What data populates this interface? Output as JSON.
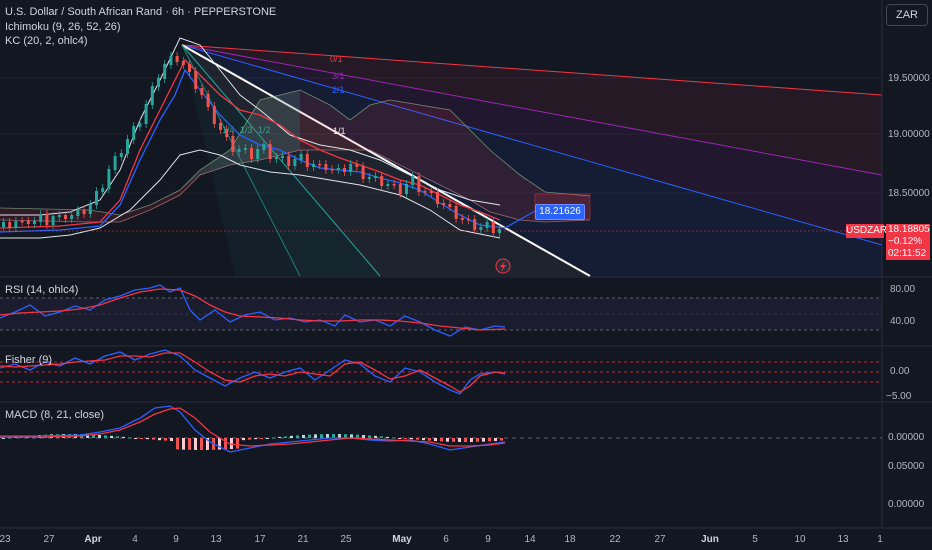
{
  "header": {
    "title": "U.S. Dollar / South African Rand · 6h · PEPPERSTONE",
    "currency_button": "ZAR"
  },
  "indicators": {
    "ichimoku": "Ichimoku (9, 26, 52, 26)",
    "keltner": "KC (20, 2, ohlc4)",
    "rsi": "RSI (14, ohlc4)",
    "fisher": "Fisher (9)",
    "macd": "MACD (8, 21, close)"
  },
  "price_axis": {
    "main": [
      "19.50000",
      "19.00000",
      "18.50000"
    ],
    "rsi": [
      "80.00",
      "40.00"
    ],
    "fisher": [
      "0.00",
      "−5.00"
    ],
    "macd": [
      "0.00000",
      "0.05000",
      "0.00000"
    ]
  },
  "last_price": {
    "symbol": "USDZAR",
    "price": "18.18805",
    "change": "−0.12%",
    "countdown": "02:11:52"
  },
  "callout": "18.21626",
  "fan_labels": [
    "0/1",
    "3/1",
    "2/1",
    "1/1",
    "1/4",
    "1/3",
    "1/2"
  ],
  "time_axis": [
    {
      "label": "23",
      "bold": false
    },
    {
      "label": "27",
      "bold": false
    },
    {
      "label": "Apr",
      "bold": true
    },
    {
      "label": "4",
      "bold": false
    },
    {
      "label": "9",
      "bold": false
    },
    {
      "label": "13",
      "bold": false
    },
    {
      "label": "17",
      "bold": false
    },
    {
      "label": "21",
      "bold": false
    },
    {
      "label": "25",
      "bold": false
    },
    {
      "label": "May",
      "bold": true
    },
    {
      "label": "6",
      "bold": false
    },
    {
      "label": "9",
      "bold": false
    },
    {
      "label": "14",
      "bold": false
    },
    {
      "label": "18",
      "bold": false
    },
    {
      "label": "22",
      "bold": false
    },
    {
      "label": "27",
      "bold": false
    },
    {
      "label": "Jun",
      "bold": true
    },
    {
      "label": "5",
      "bold": false
    },
    {
      "label": "10",
      "bold": false
    },
    {
      "label": "13",
      "bold": false
    },
    {
      "label": "1",
      "bold": false
    }
  ],
  "colors": {
    "background": "#131722",
    "up": "#26a69a",
    "down": "#ef5350",
    "blue": "#2962ff",
    "red": "#f23645"
  }
}
